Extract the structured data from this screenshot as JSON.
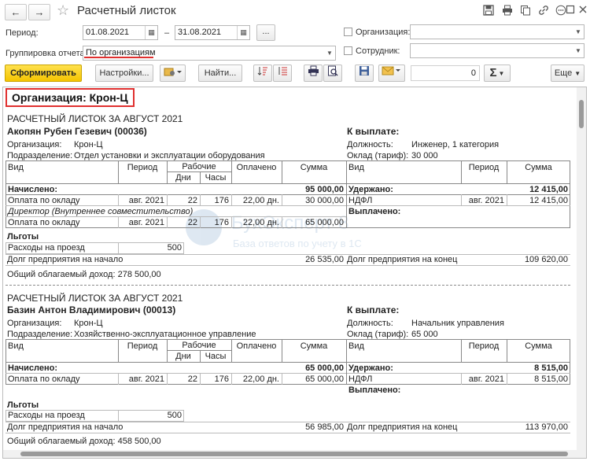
{
  "window": {
    "title": "Расчетный листок",
    "back_icon": "←",
    "forward_icon": "→",
    "favorite_icon": "☆",
    "icons": [
      "save-icon",
      "print-icon",
      "copy-icon",
      "link-icon",
      "more-icon",
      "maximize-icon",
      "close-icon"
    ]
  },
  "form": {
    "period_label": "Период:",
    "date_from": "01.08.2021",
    "date_to": "31.08.2021",
    "date_sep": "–",
    "period_btn": "...",
    "grouping_label": "Группировка отчета:",
    "grouping_value": "По организациям",
    "org_label": "Организация:",
    "employee_label": "Сотрудник:"
  },
  "toolbar": {
    "generate": "Сформировать",
    "settings": "Настройки...",
    "find": "Найти...",
    "sum_value": "0",
    "sum_symbol": "Σ",
    "more": "Еще"
  },
  "report": {
    "org_header": "Организация: Крон-Ц",
    "watermark_name": "БухЭксперт 8",
    "watermark_tag": "База ответов по учету в 1С",
    "labels": {
      "sheet_title": "РАСЧЕТНЫЙ ЛИСТОК ЗА АВГУСТ 2021",
      "to_pay": "К выплате:",
      "org": "Организация:",
      "dept": "Подразделение:",
      "position": "Должность:",
      "salary": "Оклад (тариф):",
      "col_type": "Вид",
      "col_period": "Период",
      "col_work": "Рабочие",
      "col_days": "Дни",
      "col_hours": "Часы",
      "col_paid": "Оплачено",
      "col_sum": "Сумма",
      "accrued": "Начислено:",
      "withheld": "Удержано:",
      "paid_out": "Выплачено:",
      "benefits": "Льготы",
      "debt_start": "Долг предприятия на начало",
      "debt_end": "Долг предприятия на конец"
    },
    "sheets": [
      {
        "employee": "Акопян Рубен Гезевич (00036)",
        "org": "Крон-Ц",
        "dept": "Отдел установки и эксплуатации оборудования",
        "position": "Инженер, 1 категория",
        "salary": "30 000",
        "accrued_total": "95 000,00",
        "withheld_total": "12 415,00",
        "accruals": [
          {
            "name": "Оплата по окладу",
            "period": "авг. 2021",
            "days": "22",
            "hours": "176",
            "paid": "22,00 дн.",
            "sum": "30 000,00"
          },
          {
            "name": "Оплата по окладу",
            "period": "авг. 2021",
            "days": "22",
            "hours": "176",
            "paid": "22,00 дн.",
            "sum": "65 000,00"
          }
        ],
        "position_note": "Директор (Внутреннее совместительство)",
        "deduction": {
          "name": "НДФЛ",
          "period": "авг. 2021",
          "sum": "12 415,00"
        },
        "benefit": {
          "name": "Расходы на проезд",
          "value": "500"
        },
        "debt_start": "26 535,00",
        "debt_end": "109 620,00",
        "income": "Общий облагаемый доход: 278 500,00"
      },
      {
        "employee": "Базин Антон Владимирович (00013)",
        "org": "Крон-Ц",
        "dept": "Хозяйственно-эксплуатационное управление",
        "position": "Начальник управления",
        "salary": "65 000",
        "accrued_total": "65 000,00",
        "withheld_total": "8 515,00",
        "accruals": [
          {
            "name": "Оплата по окладу",
            "period": "авг. 2021",
            "days": "22",
            "hours": "176",
            "paid": "22,00 дн.",
            "sum": "65 000,00"
          }
        ],
        "deduction": {
          "name": "НДФЛ",
          "period": "авг. 2021",
          "sum": "8 515,00"
        },
        "benefit": {
          "name": "Расходы на проезд",
          "value": "500"
        },
        "debt_start": "56 985,00",
        "debt_end": "113 970,00",
        "income": "Общий облагаемый доход: 458 500,00"
      }
    ]
  }
}
